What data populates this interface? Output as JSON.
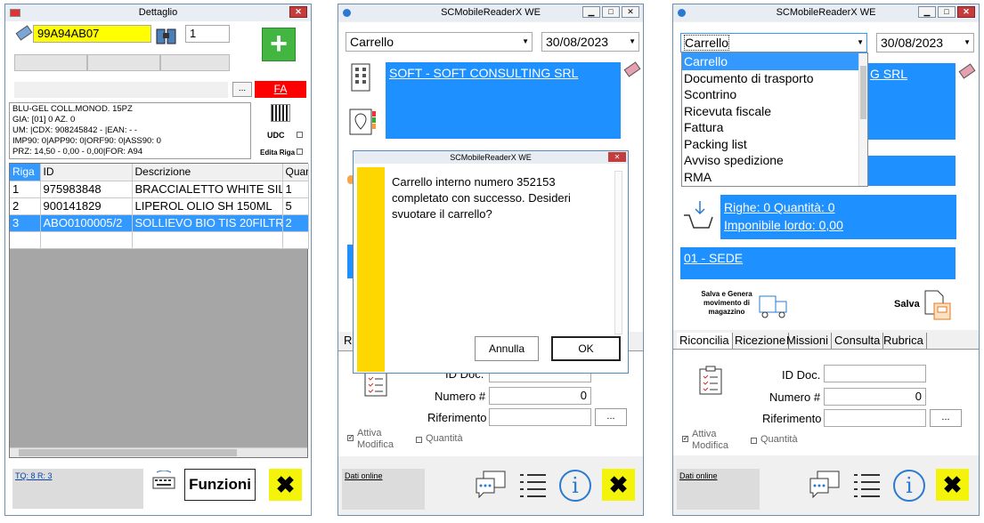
{
  "w1": {
    "title": "Dettaglio",
    "code": "99A94AB07",
    "qty": "1",
    "fa": "FA",
    "dots": "...",
    "info": [
      "BLU-GEL COLL.MONOD. 15PZ",
      "GIA: [01] 0 AZ. 0",
      "UM: |CDX: 908245842 - |EAN:  -  -",
      "IMP90: 0|APP90: 0|ORF90: 0|ASS90: 0",
      "PRZ: 14,50 - 0,00 - 0,00|FOR: A94"
    ],
    "udc": "UDC",
    "edita": "Edita Riga",
    "headers": [
      "Riga",
      "ID",
      "Descrizione",
      "Quan"
    ],
    "rows": [
      [
        "1",
        "975983848",
        "BRACCIALETTO WHITE SIL...",
        "1"
      ],
      [
        "2",
        "900141829",
        "LIPEROL OLIO SH 150ML",
        "5"
      ],
      [
        "3",
        "ABO0100005/2",
        "SOLLIEVO BIO TIS 20FILTR...",
        "2"
      ]
    ],
    "tq": "TQ: 8 R: 3",
    "funzioni": "Funzioni",
    "x": "✖"
  },
  "w2": {
    "title": "SCMobileReaderX WE",
    "doc": "Carrello",
    "date": "30/08/2023",
    "company": "SOFT - SOFT CONSULTING SRL",
    "dlg_title": "SCMobileReaderX WE",
    "dlg_msg": "Carrello interno numero 352153 completato con successo. Desideri svuotare il carrello?",
    "annulla": "Annulla",
    "ok": "OK",
    "iddoc": "ID Doc.",
    "numero": "Numero #",
    "numval": "0",
    "rif": "Riferimento",
    "dots": "...",
    "attiva": "Attiva",
    "modifica": "Modifica",
    "quantita": "Quantità",
    "dati": "Dati online",
    "x": "✖",
    "r": "Ri"
  },
  "w3": {
    "title": "SCMobileReaderX WE",
    "doc": "Carrello",
    "date": "30/08/2023",
    "company_frag": "G SRL",
    "options": [
      "Carrello",
      "Documento di trasporto",
      "Scontrino",
      "Ricevuta fiscale",
      "Fattura",
      "Packing list",
      "Avviso spedizione",
      "RMA"
    ],
    "righe": "Righe: 0 Quantità: 0",
    "imponibile": "Imponibile lordo: 0,00",
    "sede": "01 - SEDE",
    "salva_genera": "Salva e Genera movimento di magazzino",
    "salva": "Salva",
    "tabs": [
      "Riconcilia",
      "Ricezione",
      "Missioni",
      "Consulta",
      "Rubrica"
    ],
    "iddoc": "ID Doc.",
    "numero": "Numero #",
    "numval": "0",
    "rif": "Riferimento",
    "dots": "...",
    "attiva": "Attiva",
    "modifica": "Modifica",
    "quantita": "Quantità",
    "dati": "Dati online",
    "x": "✖"
  }
}
